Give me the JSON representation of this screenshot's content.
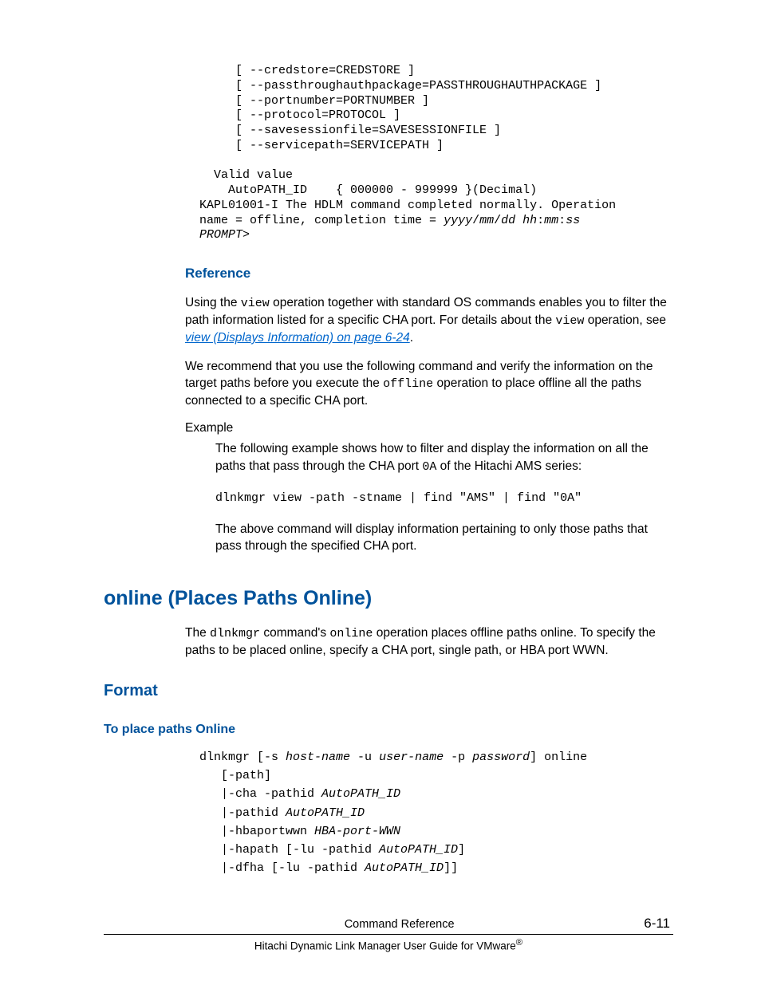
{
  "code1": "     [ --credstore=CREDSTORE ]\n     [ --passthroughauthpackage=PASSTHROUGHAUTHPACKAGE ]\n     [ --portnumber=PORTNUMBER ]\n     [ --protocol=PROTOCOL ]\n     [ --savesessionfile=SAVESESSIONFILE ]\n     [ --servicepath=SERVICEPATH ]\n\n  Valid value\n    AutoPATH_ID    { 000000 - 999999 }(Decimal)\nKAPL01001-I The HDLM command completed normally. Operation\nname = offline, completion time = ",
  "code1_ital": "yyyy",
  "code1_s1": "/",
  "code1_ital2": "mm",
  "code1_s2": "/",
  "code1_ital3": "dd hh",
  "code1_s3": ":",
  "code1_ital4": "mm",
  "code1_s4": ":",
  "code1_ital5": "ss",
  "code1_prompt": "\nPROMPT",
  "code1_gt": ">",
  "reference_heading": "Reference",
  "ref_p1_a": "Using the ",
  "ref_p1_code1": "view",
  "ref_p1_b": " operation together with standard OS commands enables you to filter the path information listed for a specific CHA port. For details about the ",
  "ref_p1_code2": "view",
  "ref_p1_c": " operation, see ",
  "ref_p1_link": "view (Displays Information) on page 6-24",
  "ref_p1_d": ".",
  "ref_p2_a": "We recommend that you use the following command and verify the information on the target paths before you execute the ",
  "ref_p2_code": "offline",
  "ref_p2_b": " operation to place offline all the paths connected to a specific CHA port.",
  "example_label": "Example",
  "example_p_a": "The following example shows how to filter and display the information on all the paths that pass through the CHA port ",
  "example_p_code": "0A",
  "example_p_b": " of the Hitachi AMS series:",
  "code2": "dlnkmgr view -path -stname | find \"AMS\" | find \"0A\"",
  "example_p2": "The above command will display information pertaining to only those paths that pass through the specified CHA port.",
  "h1": "online (Places Paths Online)",
  "body_online_a": "The ",
  "body_online_code1": "dlnkmgr",
  "body_online_b": " command's ",
  "body_online_code2": "online",
  "body_online_c": " operation places offline paths online. To specify the paths to be placed online, specify a CHA port, single path, or HBA port WWN.",
  "h2_format": "Format",
  "h4_place": "To place paths Online",
  "c3_l1_a": "dlnkmgr [-s ",
  "c3_l1_i1": "host-name",
  "c3_l1_b": " -u ",
  "c3_l1_i2": "user-name",
  "c3_l1_c": " -p ",
  "c3_l1_i3": "password",
  "c3_l1_d": "] online",
  "c3_l2": "   [-path]",
  "c3_l3_a": "   |-cha -pathid ",
  "c3_l3_i": "AutoPATH_ID",
  "c3_l4_a": "   |-pathid ",
  "c3_l4_i": "AutoPATH_ID",
  "c3_l5_a": "   |-hbaportwwn ",
  "c3_l5_i": "HBA-port-WWN",
  "c3_l6_a": "   |-hapath [-lu -pathid ",
  "c3_l6_i": "AutoPATH_ID",
  "c3_l6_b": "]",
  "c3_l7_a": "   |-dfha [-lu -pathid ",
  "c3_l7_i": "AutoPATH_ID",
  "c3_l7_b": "]]",
  "footer_center": "Command Reference",
  "footer_page": "6-11",
  "footer_sub_a": "Hitachi Dynamic Link Manager User Guide for VMware",
  "footer_sub_r": "®"
}
